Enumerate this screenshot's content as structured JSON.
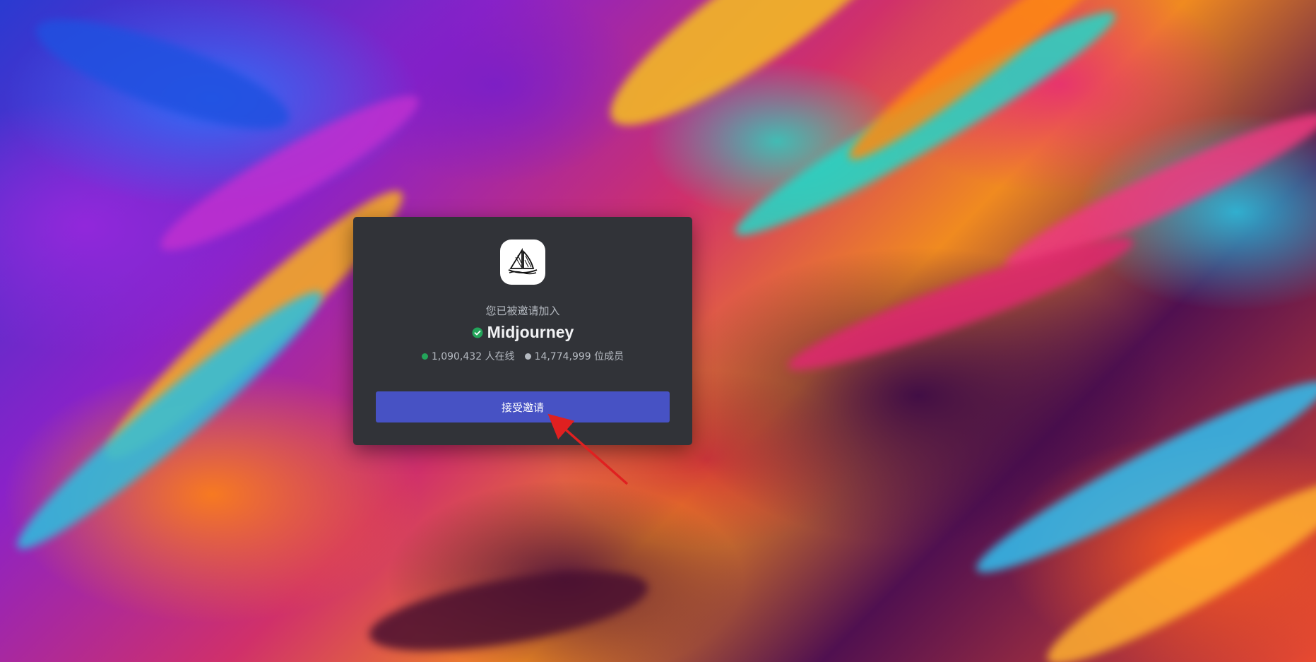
{
  "invite": {
    "intro_text": "您已被邀请加入",
    "server_name": "Midjourney",
    "online_count": "1,090,432 人在线",
    "member_count": "14,774,999 位成员",
    "accept_label": "接受邀请",
    "server_icon": "sailboat-icon",
    "verified_icon": "verified-check-icon"
  },
  "colors": {
    "card_bg": "#313338",
    "button_bg": "#4752c4",
    "online_dot": "#23a55a",
    "member_dot": "#b5bac1",
    "verified": "#23a55a",
    "annotation_arrow": "#e02020"
  }
}
